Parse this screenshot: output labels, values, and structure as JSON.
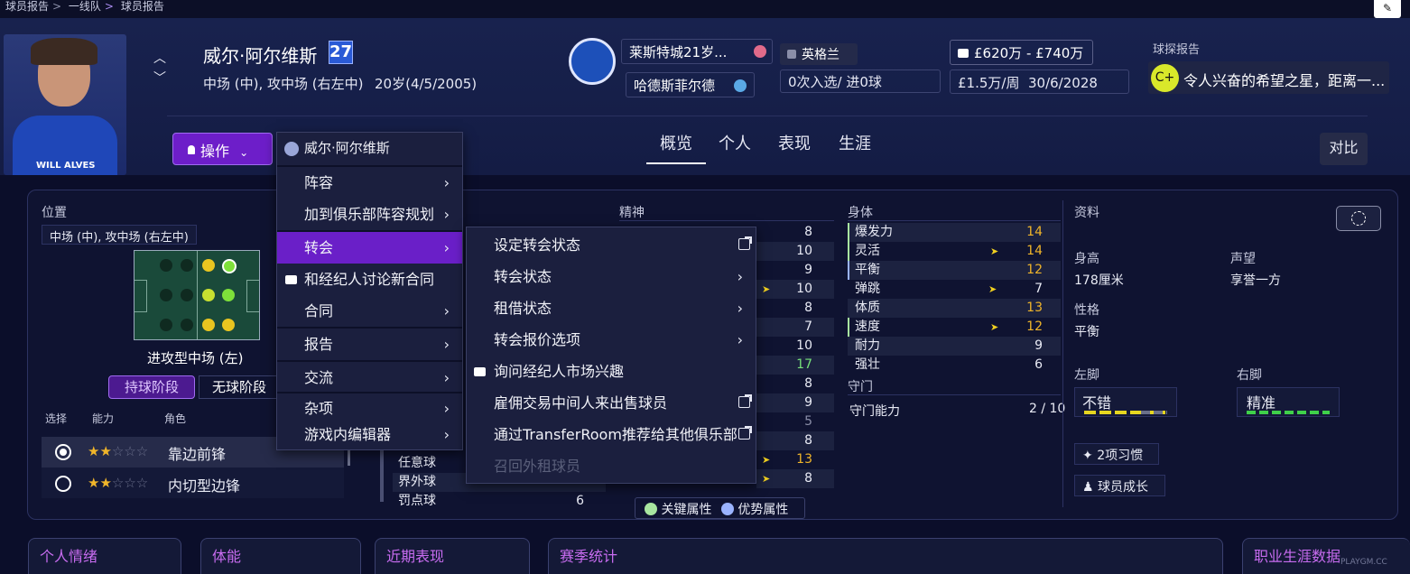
{
  "breadcrumb": [
    "球员报告",
    "一线队",
    "球员报告"
  ],
  "player": {
    "name": "威尔·阿尔维斯",
    "number": "27",
    "positions": "中场 (中), 攻中场 (右左中)",
    "age": "20岁(4/5/2005)",
    "shirt_text": "WILL ALVES"
  },
  "club": {
    "name": "莱斯特城21岁...",
    "second": "哈德斯菲尔德",
    "nation": "英格兰",
    "caps": "0次入选/ 进0球"
  },
  "contract": {
    "value": "£620万 - £740万",
    "wage": "£1.5万/周",
    "expiry": "30/6/2028"
  },
  "scout": {
    "title": "球探报告",
    "grade": "C+",
    "summary": "令人兴奋的希望之星，距离一..."
  },
  "actions_label": "操作",
  "tabs": [
    "概览",
    "个人",
    "表现",
    "生涯"
  ],
  "compare": "对比",
  "menu": {
    "title": "威尔·阿尔维斯",
    "items": [
      "阵容",
      "加到俱乐部阵容规划",
      "转会",
      "和经纪人讨论新合同",
      "合同",
      "报告",
      "交流",
      "杂项",
      "游戏内编辑器"
    ]
  },
  "submenu": {
    "items": [
      "设定转会状态",
      "转会状态",
      "租借状态",
      "转会报价选项",
      "询问经纪人市场兴趣",
      "雇佣交易中间人来出售球员",
      "通过TransferRoom推荐给其他俱乐部",
      "召回外租球员"
    ]
  },
  "position": {
    "title": "位置",
    "value": "中场 (中), 攻中场 (右左中)",
    "role_name": "进攻型中场 (左)",
    "phase_in": "持球阶段",
    "phase_out": "无球阶段",
    "col_select": "选择",
    "col_ability": "能力",
    "col_role": "角色",
    "roles": [
      {
        "name": "靠边前锋",
        "stars": 2
      },
      {
        "name": "内切型边锋",
        "stars": 2
      }
    ]
  },
  "mental": {
    "title": "精神",
    "values": [
      "8",
      "10",
      "9",
      "10",
      "8",
      "7",
      "10",
      "17",
      "8",
      "9",
      "5",
      "8",
      "13",
      "8"
    ]
  },
  "technical_tail": [
    {
      "name": "任意球",
      "value": ""
    },
    {
      "name": "界外球",
      "value": ""
    },
    {
      "name": "罚点球",
      "value": "6"
    }
  ],
  "physical": {
    "title": "身体",
    "attrs": [
      {
        "name": "爆发力",
        "value": "14"
      },
      {
        "name": "灵活",
        "value": "14"
      },
      {
        "name": "平衡",
        "value": "12"
      },
      {
        "name": "弹跳",
        "value": "7"
      },
      {
        "name": "体质",
        "value": "13"
      },
      {
        "name": "速度",
        "value": "12"
      },
      {
        "name": "耐力",
        "value": "9"
      },
      {
        "name": "强壮",
        "value": "6"
      }
    ],
    "gk_title": "守门",
    "gk_label": "守门能力",
    "gk_value": "2 / 10"
  },
  "legend": {
    "key": "关键属性",
    "strong": "优势属性"
  },
  "info": {
    "title": "资料",
    "height_label": "身高",
    "height": "178厘米",
    "rep_label": "声望",
    "rep": "享誉一方",
    "personality_label": "性格",
    "personality": "平衡",
    "left_foot_label": "左脚",
    "left_foot": "不错",
    "right_foot_label": "右脚",
    "right_foot": "精准",
    "habits": "2项习惯",
    "growth": "球员成长"
  },
  "cards": [
    "个人情绪",
    "体能",
    "近期表现",
    "赛季统计",
    "职业生涯数据"
  ],
  "watermark": "PLAYGM.CC"
}
